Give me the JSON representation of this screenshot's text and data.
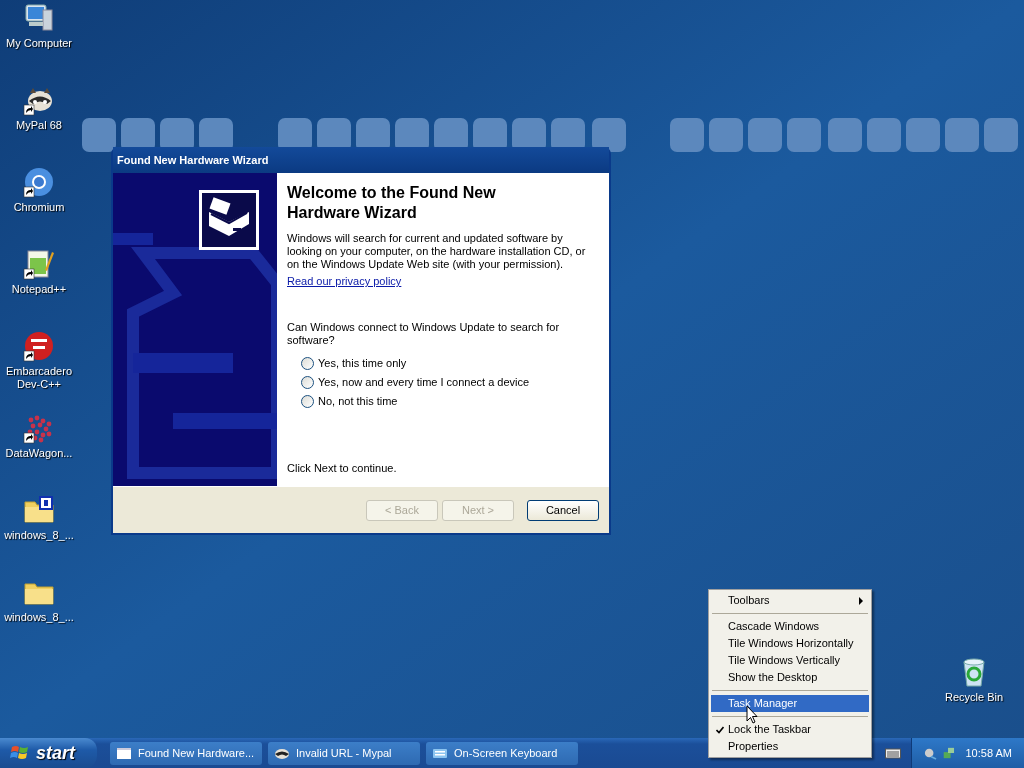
{
  "desktop_icons": [
    {
      "label": "My Computer",
      "kind": "computer",
      "shortcut": false
    },
    {
      "label": "MyPal 68",
      "kind": "raccoon",
      "shortcut": true
    },
    {
      "label": "Chromium",
      "kind": "browser",
      "shortcut": true
    },
    {
      "label": "Notepad++",
      "kind": "notepad",
      "shortcut": true
    },
    {
      "label": "Embarcadero Dev-C++",
      "kind": "dev",
      "shortcut": true
    },
    {
      "label": "DataWagon...",
      "kind": "dots",
      "shortcut": true
    },
    {
      "label": "windows_8_...",
      "kind": "folder-r",
      "shortcut": false
    },
    {
      "label": "windows_8_...",
      "kind": "folder",
      "shortcut": false
    }
  ],
  "recycle_bin": {
    "label": "Recycle Bin"
  },
  "wizard": {
    "title": "Found New Hardware Wizard",
    "heading": "Welcome to the Found New Hardware Wizard",
    "body": "Windows will search for current and updated software by looking on your computer, on the hardware installation CD, or on the Windows Update Web site (with your permission).",
    "link": "Read our privacy policy",
    "question": "Can Windows connect to Windows Update to search for software?",
    "options": [
      {
        "label": "Yes, this time only",
        "selected": false
      },
      {
        "label": "Yes, now and every time I connect a device",
        "selected": false
      },
      {
        "label": "No, not this time",
        "selected": false
      }
    ],
    "footer": "Click Next to continue.",
    "buttons": [
      {
        "label": "< Back",
        "disabled": true
      },
      {
        "label": "Next >",
        "disabled": true
      },
      {
        "label": "Cancel",
        "disabled": false
      }
    ]
  },
  "context_menu": {
    "groups": [
      [
        {
          "label": "Toolbars",
          "submenu": true,
          "checked": false,
          "selected": false
        }
      ],
      [
        {
          "label": "Cascade Windows",
          "submenu": false,
          "checked": false,
          "selected": false
        },
        {
          "label": "Tile Windows Horizontally",
          "submenu": false,
          "checked": false,
          "selected": false
        },
        {
          "label": "Tile Windows Vertically",
          "submenu": false,
          "checked": false,
          "selected": false
        },
        {
          "label": "Show the Desktop",
          "submenu": false,
          "checked": false,
          "selected": false
        }
      ],
      [
        {
          "label": "Task Manager",
          "submenu": false,
          "checked": false,
          "selected": true
        }
      ],
      [
        {
          "label": "Lock the Taskbar",
          "submenu": false,
          "checked": true,
          "selected": false
        },
        {
          "label": "Properties",
          "submenu": false,
          "checked": false,
          "selected": false
        }
      ]
    ]
  },
  "taskbar": {
    "start": "start",
    "tasks": [
      {
        "label": "Found New Hardware...",
        "kind": "window",
        "selected": false
      },
      {
        "label": "Invalid URL - Mypal",
        "kind": "raccoon",
        "selected": false
      },
      {
        "label": "On-Screen Keyboard",
        "kind": "keyboard",
        "selected": false
      }
    ],
    "clock": "10:58 AM"
  }
}
